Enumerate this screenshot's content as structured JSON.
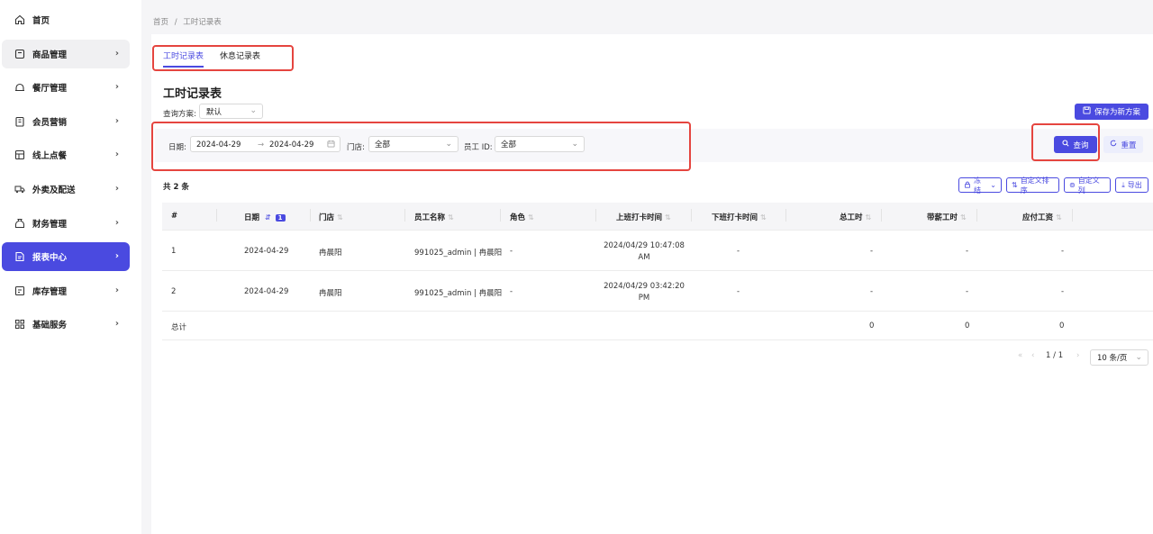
{
  "sidebar": {
    "items": [
      {
        "label": "首页",
        "icon": "home-icon"
      },
      {
        "label": "商品管理",
        "icon": "product-icon"
      },
      {
        "label": "餐厅管理",
        "icon": "restaurant-icon"
      },
      {
        "label": "会员营销",
        "icon": "member-icon"
      },
      {
        "label": "线上点餐",
        "icon": "online-order-icon"
      },
      {
        "label": "外卖及配送",
        "icon": "delivery-icon"
      },
      {
        "label": "财务管理",
        "icon": "finance-icon"
      },
      {
        "label": "报表中心",
        "icon": "report-icon"
      },
      {
        "label": "库存管理",
        "icon": "inventory-icon"
      },
      {
        "label": "基础服务",
        "icon": "grid-icon"
      }
    ],
    "active_index": 7
  },
  "breadcrumb": {
    "home": "首页",
    "sep": "/",
    "current": "工时记录表"
  },
  "tabs": [
    {
      "label": "工时记录表",
      "active": true
    },
    {
      "label": "休息记录表",
      "active": false
    }
  ],
  "page_title": "工时记录表",
  "scheme": {
    "label": "查询方案:",
    "value": "默认",
    "save_button": "保存为新方案"
  },
  "filters": {
    "date_label": "日期:",
    "date_start": "2024-04-29",
    "date_arrow": "→",
    "date_end": "2024-04-29",
    "store_label": "门店:",
    "store_value": "全部",
    "employee_label": "员工 ID:",
    "employee_value": "全部"
  },
  "actions": {
    "query": "查询",
    "reset": "重置"
  },
  "summary": {
    "count_text": "共 2 条"
  },
  "toolbar": {
    "freeze": "冻结",
    "custom_sort": "自定义排序",
    "custom_columns": "自定义列",
    "export": "导出"
  },
  "table": {
    "headers": [
      "#",
      "日期",
      "门店",
      "员工名称",
      "角色",
      "上班打卡时间",
      "下班打卡时间",
      "总工时",
      "带薪工时",
      "应付工资"
    ],
    "date_sort_badge": "1",
    "rows": [
      {
        "no": "1",
        "date": "2024-04-29",
        "store": "冉晨阳",
        "name": "991025_admin | 冉晨阳",
        "role": "-",
        "clock_in_line1": "2024/04/29 10:47:08",
        "clock_in_line2": "AM",
        "clock_out": "-",
        "total": "-",
        "paid": "-",
        "wage": "-"
      },
      {
        "no": "2",
        "date": "2024-04-29",
        "store": "冉晨阳",
        "name": "991025_admin | 冉晨阳",
        "role": "-",
        "clock_in_line1": "2024/04/29 03:42:20",
        "clock_in_line2": "PM",
        "clock_out": "-",
        "total": "-",
        "paid": "-",
        "wage": "-"
      }
    ],
    "totals": {
      "label": "总计",
      "total": "0",
      "paid": "0",
      "wage": "0"
    }
  },
  "pagination": {
    "current": "1",
    "sep": "/",
    "total": "1",
    "page_size": "10 条/页"
  },
  "colors": {
    "accent": "#4a4ae0",
    "highlight": "#e5453f"
  }
}
